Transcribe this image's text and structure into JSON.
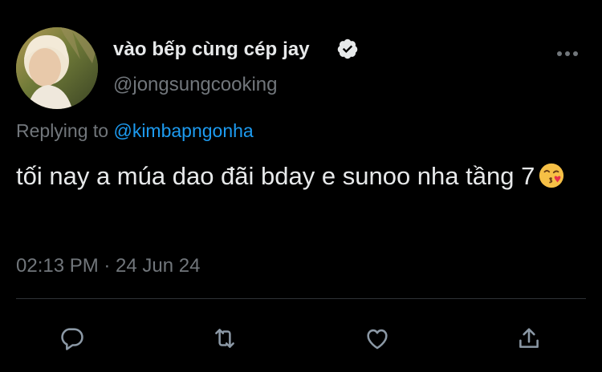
{
  "author": {
    "display_name": "vào bếp cùng cép jay",
    "handle": "@jongsungcooking",
    "verified": true,
    "verified_icon": "verified-badge-icon"
  },
  "reply": {
    "prefix": "Replying to",
    "mention": "@kimbapngonha"
  },
  "tweet": {
    "text": "tối nay a múa dao đãi bday e sunoo nha tầng 7",
    "emoji": "face-blowing-a-kiss-icon",
    "timestamp": "02:13 PM · 24 Jun 24"
  },
  "actions": {
    "reply_icon": "reply-icon",
    "retweet_icon": "retweet-icon",
    "like_icon": "heart-icon",
    "share_icon": "share-icon"
  },
  "colors": {
    "background": "#000000",
    "text_primary": "#e7e9ea",
    "text_secondary": "#71767b",
    "link": "#1d9bf0",
    "divider": "#2f3336"
  }
}
